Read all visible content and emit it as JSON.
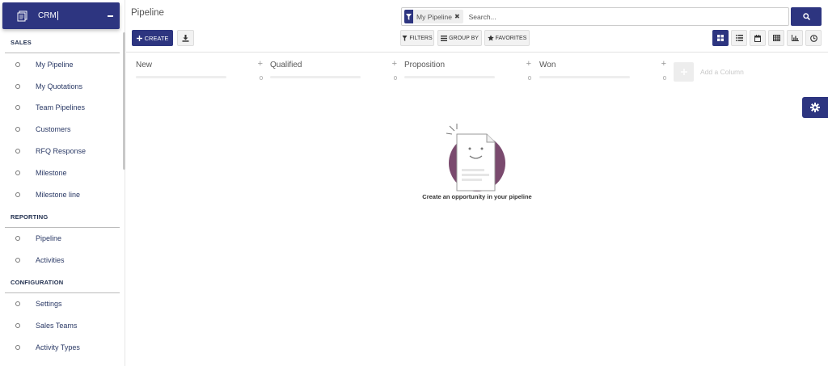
{
  "app": {
    "name": "CRM",
    "icon": "document-stack-icon"
  },
  "sidebar": {
    "sections": [
      {
        "title": "SALES",
        "items": [
          {
            "label": "My Pipeline"
          },
          {
            "label": "My Quotations"
          },
          {
            "label": "Team Pipelines"
          },
          {
            "label": "Customers"
          },
          {
            "label": "RFQ Response"
          },
          {
            "label": "Milestone"
          },
          {
            "label": "Milestone line"
          }
        ]
      },
      {
        "title": "REPORTING",
        "items": [
          {
            "label": "Pipeline"
          },
          {
            "label": "Activities"
          }
        ]
      },
      {
        "title": "CONFIGURATION",
        "items": [
          {
            "label": "Settings"
          },
          {
            "label": "Sales Teams"
          },
          {
            "label": "Activity Types"
          }
        ]
      }
    ]
  },
  "page": {
    "title": "Pipeline"
  },
  "toolbar": {
    "create_label": "CREATE",
    "filters_label": "FILTERS",
    "group_by_label": "GROUP BY",
    "favorites_label": "FAVORITES"
  },
  "search": {
    "facet_label": "My Pipeline",
    "placeholder": "Search..."
  },
  "views": [
    "kanban-icon",
    "list-icon",
    "calendar-icon",
    "pivot-icon",
    "graph-icon",
    "activity-clock-icon"
  ],
  "kanban": {
    "columns": [
      {
        "title": "New",
        "count": "0"
      },
      {
        "title": "Qualified",
        "count": "0"
      },
      {
        "title": "Proposition",
        "count": "0"
      },
      {
        "title": "Won",
        "count": "0"
      }
    ],
    "add_column_label": "Add a Column",
    "empty_message": "Create an opportunity in your pipeline"
  },
  "colors": {
    "brand": "#2d3580",
    "illustration_circle": "#7a4a6e"
  }
}
